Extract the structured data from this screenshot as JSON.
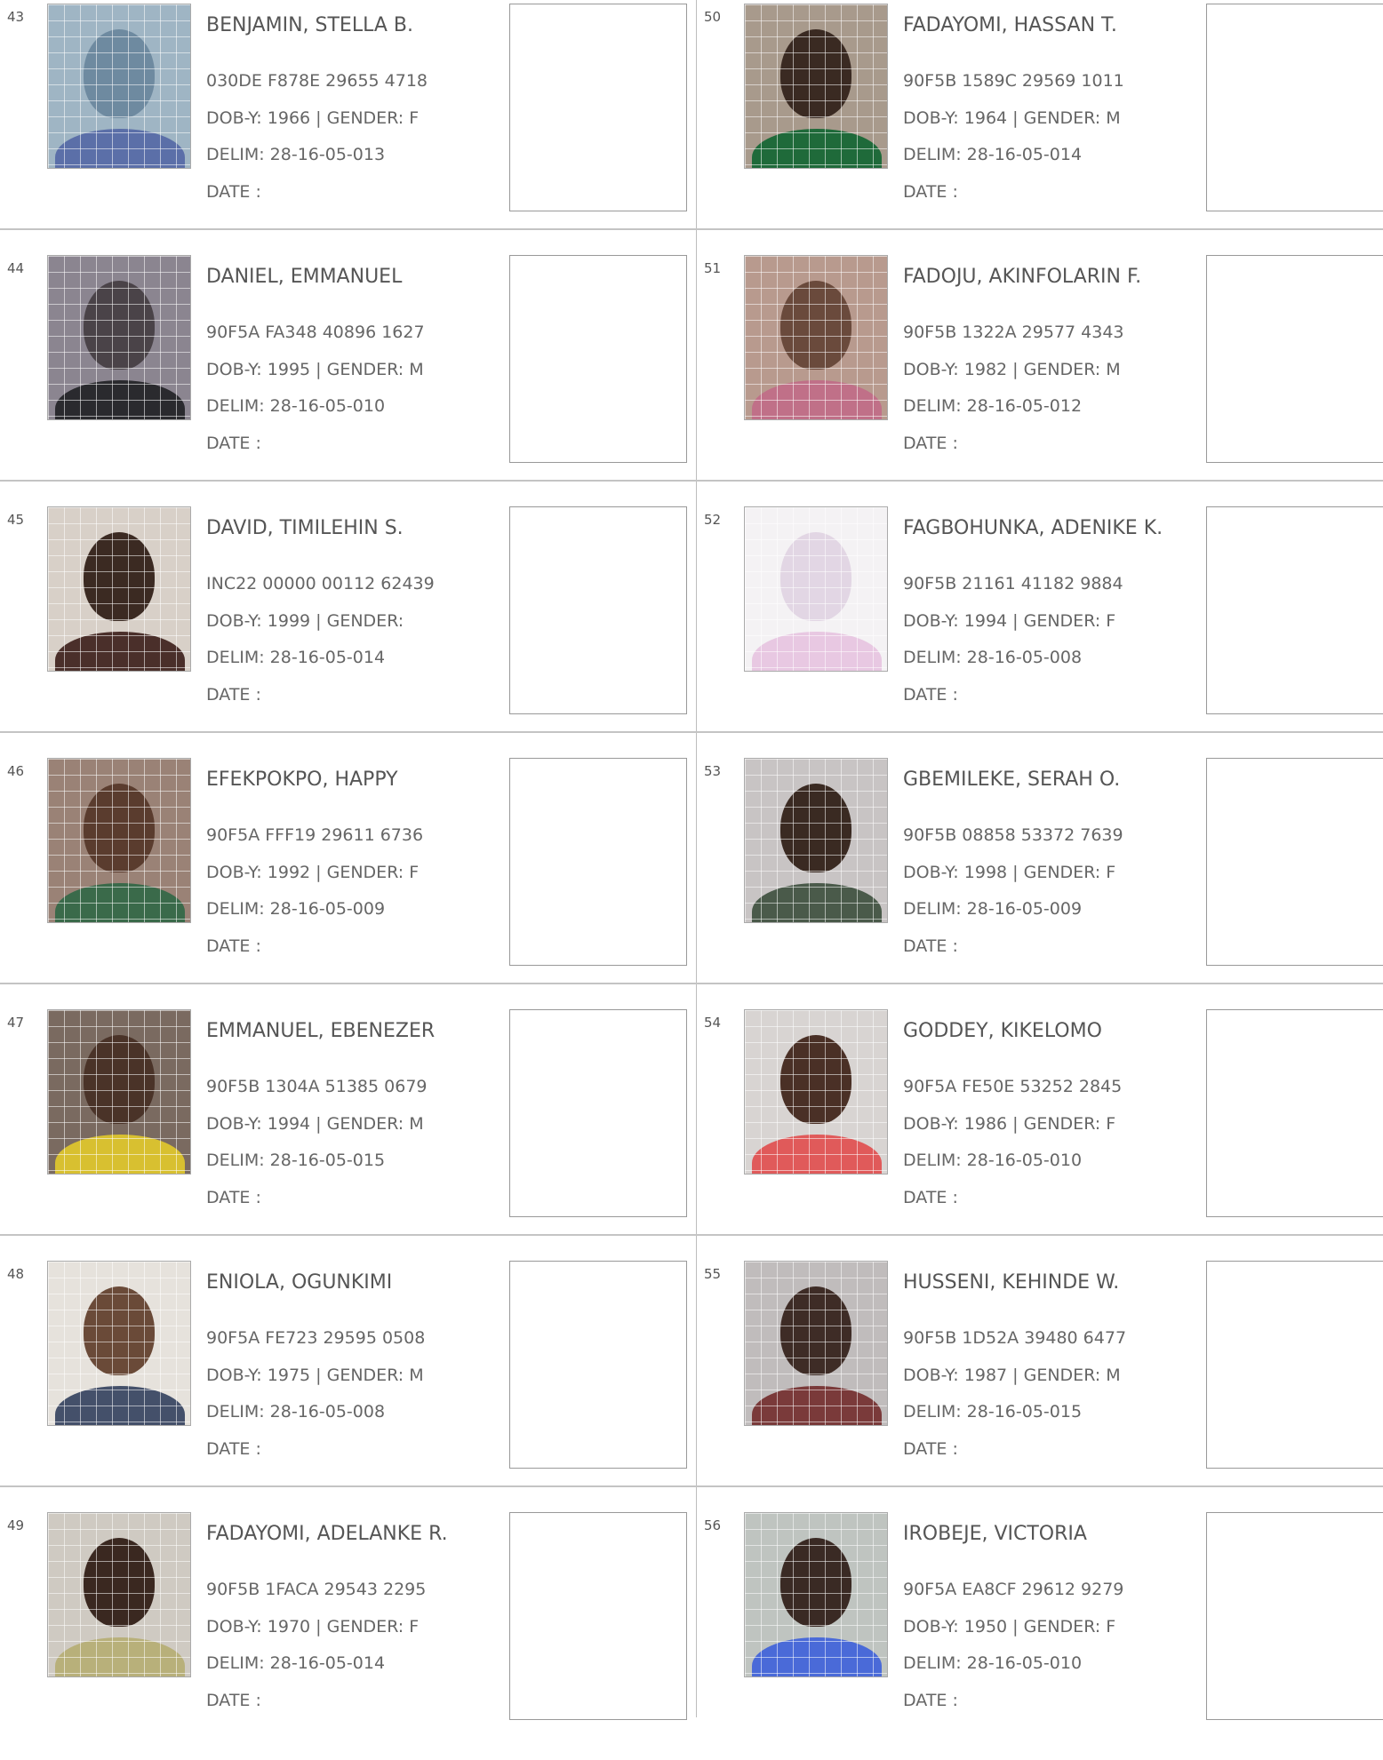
{
  "entries": [
    {
      "serial": "43",
      "name": "BENJAMIN, STELLA B.",
      "vin": "030DE F878E 29655 4718",
      "dob_year": "1966",
      "gender": "F",
      "delim": "28-16-05-013",
      "skin": "#6e8aa0",
      "shirt": "#5b6fa8",
      "bg": "#9fb5c4"
    },
    {
      "serial": "44",
      "name": "DANIEL, EMMANUEL",
      "vin": "90F5A FA348 40896 1627",
      "dob_year": "1995",
      "gender": "M",
      "delim": "28-16-05-010",
      "skin": "#4a4348",
      "shirt": "#2a2a2e",
      "bg": "#8b8590"
    },
    {
      "serial": "45",
      "name": "DAVID, TIMILEHIN S.",
      "vin": "INC22 00000 00112 62439",
      "dob_year": "1999",
      "gender": "",
      "delim": "28-16-05-014",
      "skin": "#3b2a22",
      "shirt": "#4a2f2a",
      "bg": "#d8d0c8"
    },
    {
      "serial": "46",
      "name": "EFEKPOKPO, HAPPY",
      "vin": "90F5A FFF19 29611 6736",
      "dob_year": "1992",
      "gender": "F",
      "delim": "28-16-05-009",
      "skin": "#5a3c2e",
      "shirt": "#3a6a4a",
      "bg": "#9a8276"
    },
    {
      "serial": "47",
      "name": "EMMANUEL, EBENEZER",
      "vin": "90F5B 1304A 51385 0679",
      "dob_year": "1994",
      "gender": "M",
      "delim": "28-16-05-015",
      "skin": "#4a3328",
      "shirt": "#d8c030",
      "bg": "#7a6a60"
    },
    {
      "serial": "48",
      "name": "ENIOLA, OGUNKIMI",
      "vin": "90F5A FE723 29595 0508",
      "dob_year": "1975",
      "gender": "M",
      "delim": "28-16-05-008",
      "skin": "#6a4a38",
      "shirt": "#44506a",
      "bg": "#e6e2dc"
    },
    {
      "serial": "49",
      "name": "FADAYOMI, ADELANKE R.",
      "vin": "90F5B 1FACA 29543 2295",
      "dob_year": "1970",
      "gender": "F",
      "delim": "28-16-05-014",
      "skin": "#3a2820",
      "shirt": "#b8b07a",
      "bg": "#cfcac2"
    },
    {
      "serial": "50",
      "name": "FADAYOMI, HASSAN T.",
      "vin": "90F5B 1589C 29569 1011",
      "dob_year": "1964",
      "gender": "M",
      "delim": "28-16-05-014",
      "skin": "#3a2a22",
      "shirt": "#1f6a3a",
      "bg": "#a89a8c"
    },
    {
      "serial": "51",
      "name": "FADOJU, AKINFOLARIN F.",
      "vin": "90F5B 1322A 29577 4343",
      "dob_year": "1982",
      "gender": "M",
      "delim": "28-16-05-012",
      "skin": "#6a4a3c",
      "shirt": "#c07088",
      "bg": "#b89a8e"
    },
    {
      "serial": "52",
      "name": "FAGBOHUNKA, ADENIKE K.",
      "vin": "90F5B 21161 41182 9884",
      "dob_year": "1994",
      "gender": "F",
      "delim": "28-16-05-008",
      "skin": "#e2d6e4",
      "shirt": "#e8c8e2",
      "bg": "#f4f2f4"
    },
    {
      "serial": "53",
      "name": "GBEMILEKE, SERAH O.",
      "vin": "90F5B 08858 53372 7639",
      "dob_year": "1998",
      "gender": "F",
      "delim": "28-16-05-009",
      "skin": "#3a2a22",
      "shirt": "#4a5a4a",
      "bg": "#c8c4c4"
    },
    {
      "serial": "54",
      "name": "GODDEY, KIKELOMO",
      "vin": "90F5A FE50E 53252 2845",
      "dob_year": "1986",
      "gender": "F",
      "delim": "28-16-05-010",
      "skin": "#4a3026",
      "shirt": "#e05a5a",
      "bg": "#d8d4d2"
    },
    {
      "serial": "55",
      "name": "HUSSENI, KEHINDE W.",
      "vin": "90F5B 1D52A 39480 6477",
      "dob_year": "1987",
      "gender": "M",
      "delim": "28-16-05-015",
      "skin": "#3e2c26",
      "shirt": "#7a3a3a",
      "bg": "#c0bcbc"
    },
    {
      "serial": "56",
      "name": "IROBEJE, VICTORIA",
      "vin": "90F5A EA8CF 29612 9279",
      "dob_year": "1950",
      "gender": "F",
      "delim": "28-16-05-010",
      "skin": "#3a2a24",
      "shirt": "#4a6ad8",
      "bg": "#bfc4c0"
    }
  ],
  "labels": {
    "dob": "DOB-Y:",
    "gender": "| GENDER:",
    "delim": "DELIM:",
    "date": "DATE  :"
  }
}
